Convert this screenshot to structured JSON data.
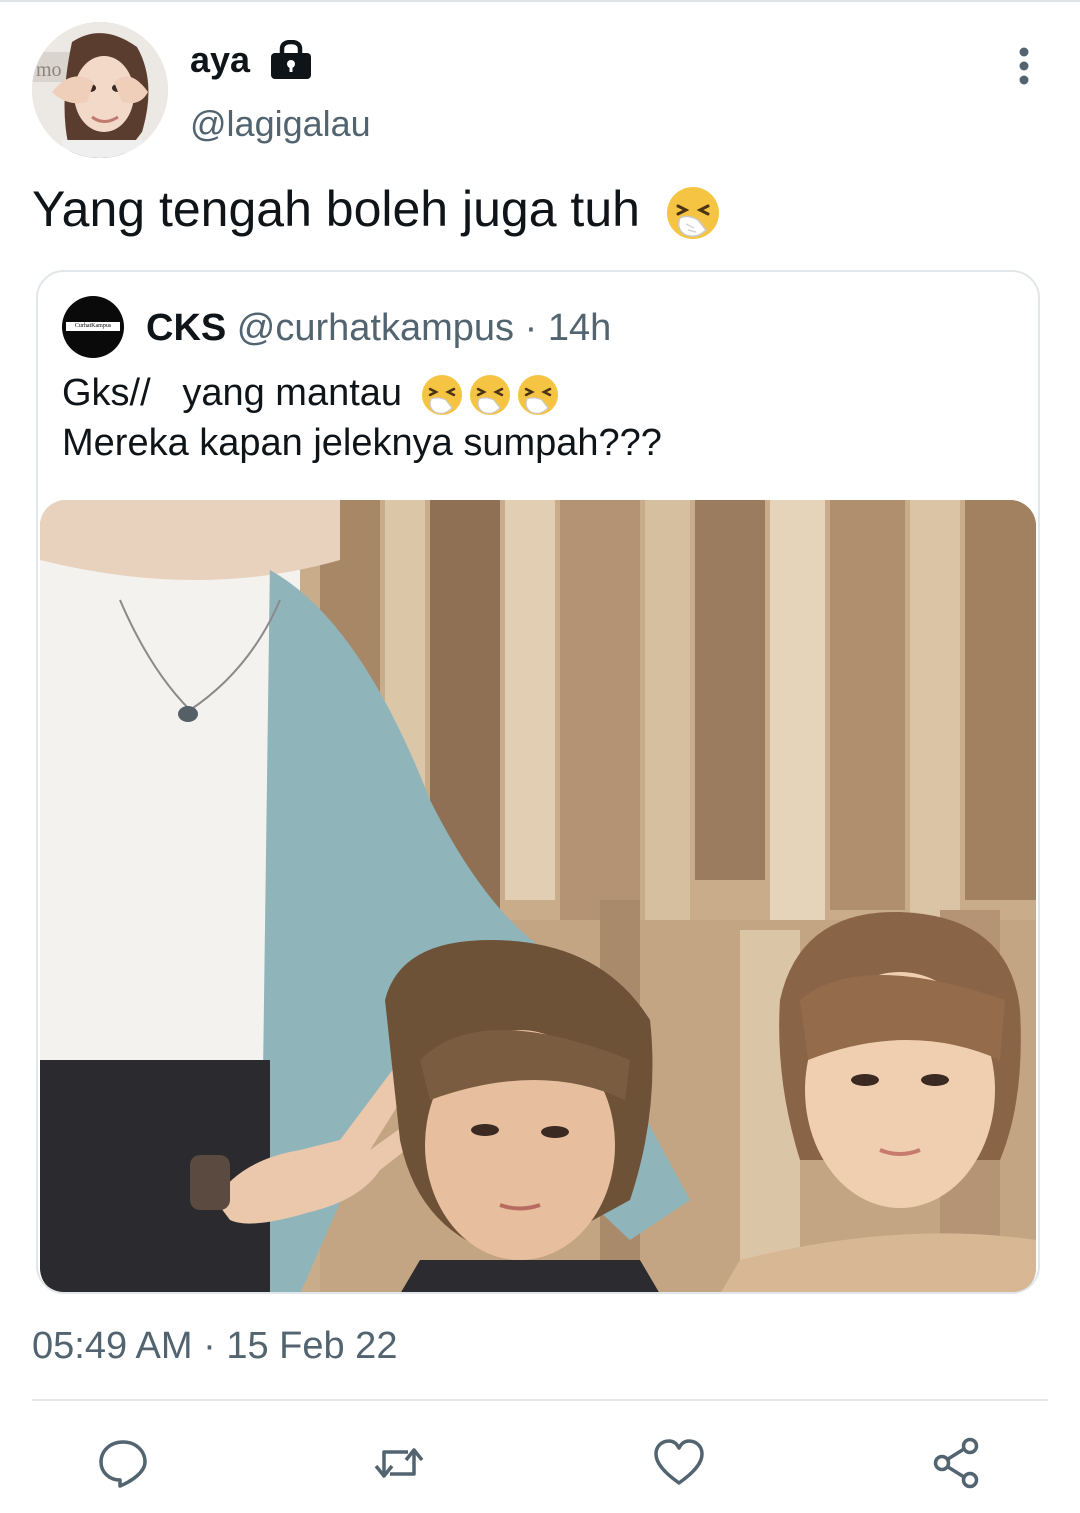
{
  "tweet": {
    "display_name": "aya",
    "handle": "@lagigalau",
    "text": "Yang tengah boleh juga tuh",
    "emoji": "sneezing-face-emoji",
    "timestamp": "05:49 AM · 15 Feb 22",
    "avatar_sign_text": "mo",
    "lock_icon": "lock-icon",
    "more_icon": "more-vertical-icon"
  },
  "quote": {
    "name": "CKS",
    "handle": "@curhatkampus",
    "separator": "·",
    "time": "14h",
    "avatar_text": "CurhatKampus",
    "line1": "Gks//   yang mantau",
    "line1_emoji_count": 3,
    "line2": "Mereka kapan jeleknya sumpah???"
  },
  "actions": [
    {
      "name": "reply",
      "icon": "reply-icon"
    },
    {
      "name": "retweet",
      "icon": "retweet-icon"
    },
    {
      "name": "like",
      "icon": "heart-icon"
    },
    {
      "name": "share",
      "icon": "share-icon"
    }
  ],
  "colors": {
    "text_primary": "#0f1419",
    "text_secondary": "#536471",
    "border": "#e1e6ea",
    "icon": "#536471"
  }
}
